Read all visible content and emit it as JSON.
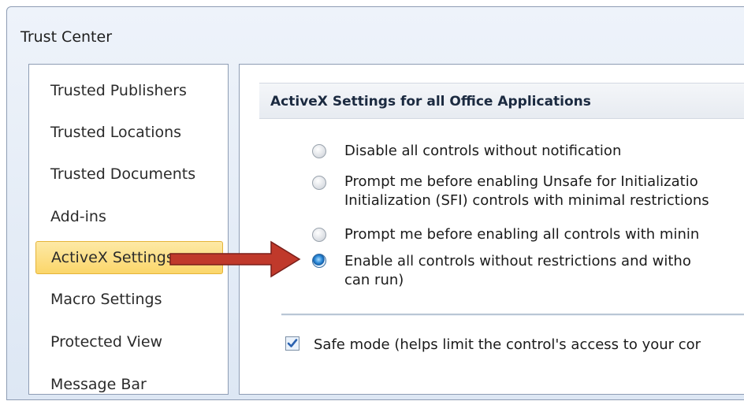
{
  "window": {
    "title": "Trust Center"
  },
  "sidebar": {
    "items": [
      {
        "label": "Trusted Publishers"
      },
      {
        "label": "Trusted Locations"
      },
      {
        "label": "Trusted Documents"
      },
      {
        "label": "Add-ins"
      },
      {
        "label": "ActiveX Settings",
        "selected": true
      },
      {
        "label": "Macro Settings"
      },
      {
        "label": "Protected View"
      },
      {
        "label": "Message Bar"
      }
    ]
  },
  "main": {
    "section_title": "ActiveX Settings for all Office Applications",
    "options": [
      {
        "lines": [
          "Disable all controls without notification"
        ],
        "checked": false
      },
      {
        "lines": [
          "Prompt me before enabling Unsafe for Initializatio",
          "Initialization (SFI) controls with minimal restrictions"
        ],
        "checked": false
      },
      {
        "lines": [
          "Prompt me before enabling all controls with minin"
        ],
        "checked": false
      },
      {
        "lines": [
          "Enable all controls without restrictions and witho",
          "can run)"
        ],
        "checked": true
      }
    ],
    "safe_mode": {
      "label": "Safe mode (helps limit the control's access to your cor",
      "checked": true
    }
  },
  "annotation": {
    "arrow_color": "#c0392b"
  }
}
